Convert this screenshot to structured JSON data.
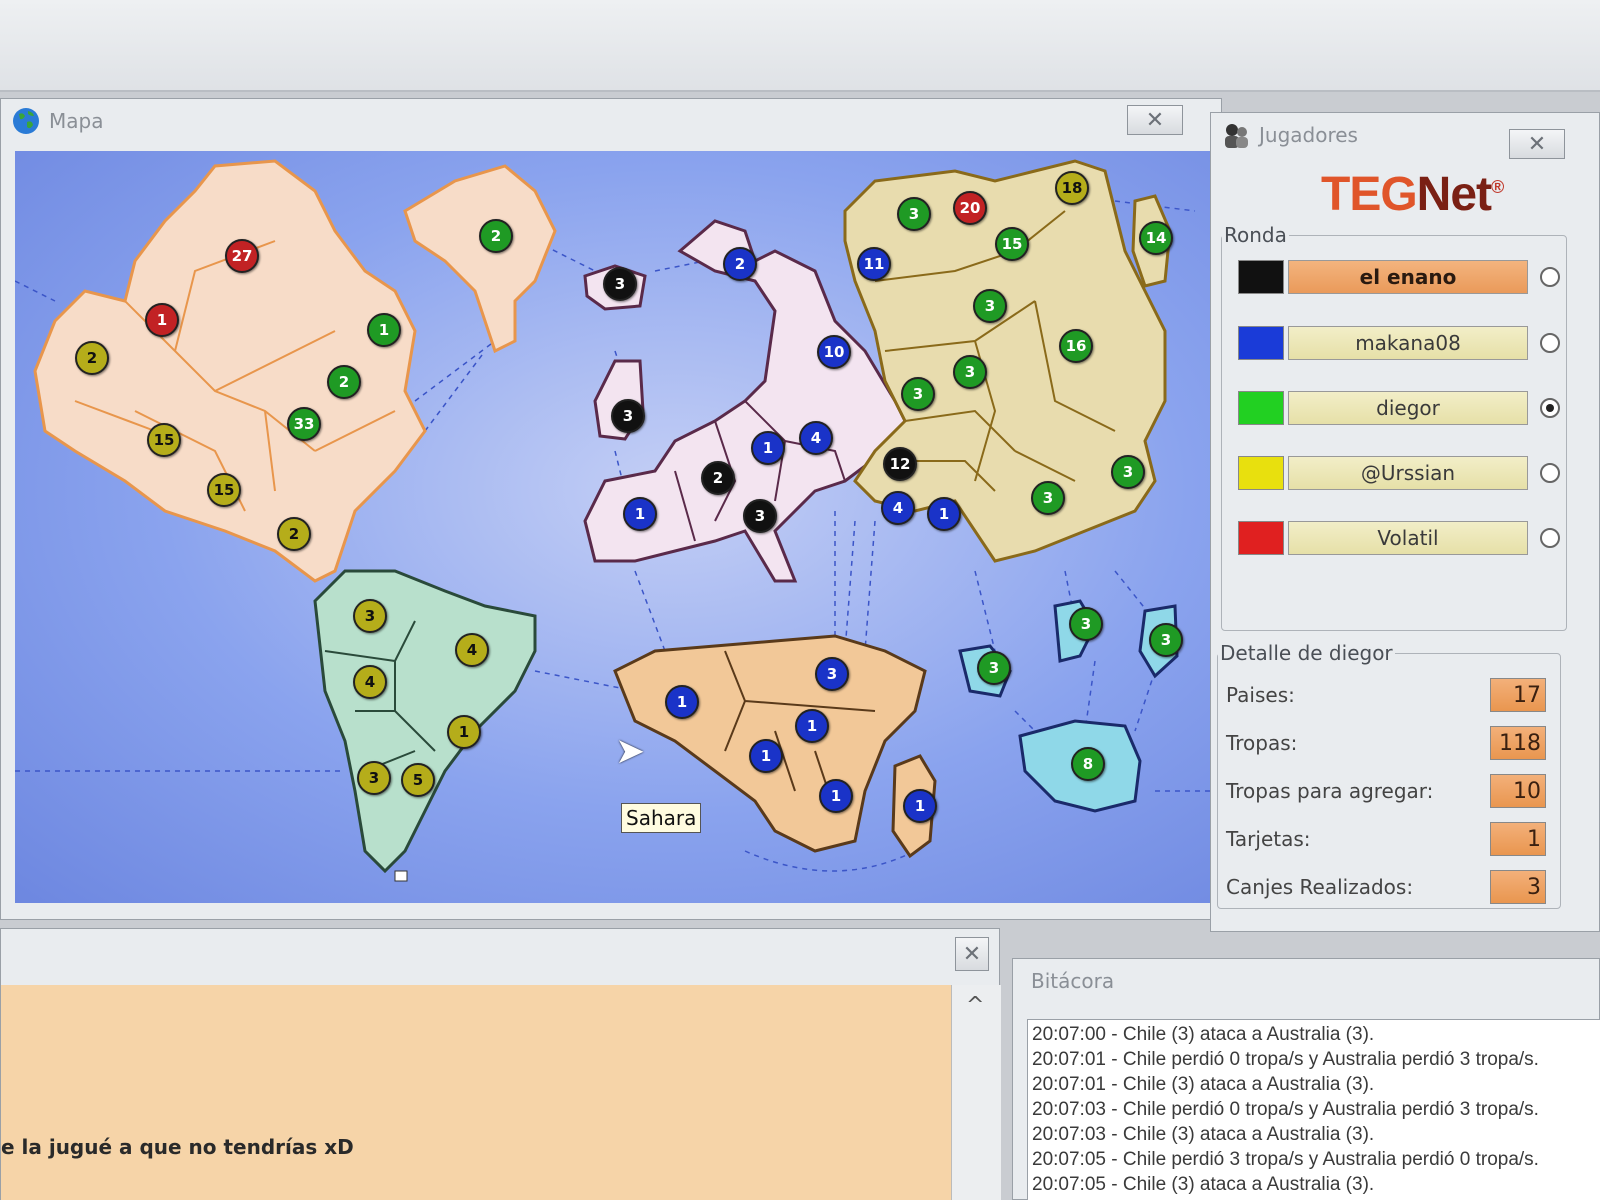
{
  "map_window": {
    "title": "Mapa",
    "close_glyph": "✕",
    "tooltip": "Sahara"
  },
  "markers": [
    {
      "c": "red",
      "v": "27"
    },
    {
      "c": "red",
      "v": "1"
    },
    {
      "c": "yellow",
      "v": "2"
    },
    {
      "c": "green",
      "v": "1"
    },
    {
      "c": "green",
      "v": "2"
    },
    {
      "c": "green",
      "v": "33"
    },
    {
      "c": "yellow",
      "v": "15"
    },
    {
      "c": "yellow",
      "v": "15"
    },
    {
      "c": "yellow",
      "v": "2"
    },
    {
      "c": "green",
      "v": "2"
    },
    {
      "c": "black",
      "v": "3"
    },
    {
      "c": "black",
      "v": "3"
    },
    {
      "c": "blue",
      "v": "2"
    },
    {
      "c": "blue",
      "v": "10"
    },
    {
      "c": "blue",
      "v": "1"
    },
    {
      "c": "blue",
      "v": "4"
    },
    {
      "c": "black",
      "v": "2"
    },
    {
      "c": "blue",
      "v": "1"
    },
    {
      "c": "black",
      "v": "3"
    },
    {
      "c": "black",
      "v": "12"
    },
    {
      "c": "blue",
      "v": "4"
    },
    {
      "c": "blue",
      "v": "1"
    },
    {
      "c": "blue",
      "v": "11"
    },
    {
      "c": "green",
      "v": "3"
    },
    {
      "c": "red",
      "v": "20"
    },
    {
      "c": "yellow",
      "v": "18"
    },
    {
      "c": "green",
      "v": "15"
    },
    {
      "c": "green",
      "v": "14"
    },
    {
      "c": "green",
      "v": "3"
    },
    {
      "c": "green",
      "v": "16"
    },
    {
      "c": "green",
      "v": "3"
    },
    {
      "c": "green",
      "v": "3"
    },
    {
      "c": "green",
      "v": "3"
    },
    {
      "c": "green",
      "v": "3"
    },
    {
      "c": "yellow",
      "v": "3"
    },
    {
      "c": "yellow",
      "v": "4"
    },
    {
      "c": "yellow",
      "v": "4"
    },
    {
      "c": "yellow",
      "v": "1"
    },
    {
      "c": "yellow",
      "v": "3"
    },
    {
      "c": "yellow",
      "v": "5"
    },
    {
      "c": "blue",
      "v": "1"
    },
    {
      "c": "blue",
      "v": "3"
    },
    {
      "c": "blue",
      "v": "1"
    },
    {
      "c": "blue",
      "v": "1"
    },
    {
      "c": "blue",
      "v": "1"
    },
    {
      "c": "blue",
      "v": "1"
    },
    {
      "c": "green",
      "v": "3"
    },
    {
      "c": "green",
      "v": "3"
    },
    {
      "c": "green",
      "v": "3"
    },
    {
      "c": "green",
      "v": "8"
    }
  ],
  "players_window": {
    "title": "Jugadores",
    "close_glyph": "✕",
    "logo_teg": "TEG",
    "logo_net": "Net",
    "logo_reg": "®",
    "ronda_label": "Ronda",
    "players": [
      {
        "name": "el enano",
        "color": "#111111"
      },
      {
        "name": "makana08",
        "color": "#1a3bd8"
      },
      {
        "name": "diegor",
        "color": "#22d022"
      },
      {
        "name": "@Urssian",
        "color": "#e8e00e"
      },
      {
        "name": "Volatil",
        "color": "#e02020"
      }
    ],
    "detail_label": "Detalle de diegor",
    "details": [
      {
        "label": "Paises:",
        "value": "17"
      },
      {
        "label": "Tropas:",
        "value": "118"
      },
      {
        "label": "Tropas para agregar:",
        "value": "10"
      },
      {
        "label": "Tarjetas:",
        "value": "1"
      },
      {
        "label": "Canjes Realizados:",
        "value": "3"
      }
    ]
  },
  "chat": {
    "close_glyph": "✕",
    "text": "e la jugué a que no tendrías xD",
    "scroll_up": "^"
  },
  "bitacora": {
    "title": "Bitácora",
    "lines": [
      "20:07:00 - Chile (3) ataca a Australia (3).",
      "20:07:01 - Chile perdió 0 tropa/s y Australia perdió 3 tropa/s.",
      "20:07:01 - Chile (3) ataca a Australia (3).",
      "20:07:03 - Chile perdió 0 tropa/s y Australia perdió 3 tropa/s.",
      "20:07:03 - Chile (3) ataca a Australia (3).",
      "20:07:05 - Chile perdió 3 tropa/s y Australia perdió 0 tropa/s.",
      "20:07:05 - Chile (3) ataca a Australia (3)."
    ]
  }
}
